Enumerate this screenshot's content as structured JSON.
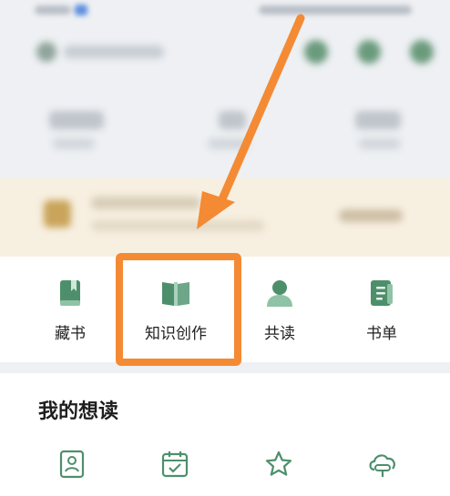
{
  "actions": [
    {
      "label": "藏书",
      "icon": "bookmark-book-icon"
    },
    {
      "label": "知识创作",
      "icon": "open-book-icon"
    },
    {
      "label": "共读",
      "icon": "person-icon"
    },
    {
      "label": "书单",
      "icon": "list-document-icon"
    }
  ],
  "wishlist": {
    "title": "我的想读",
    "icons": [
      "profile-card-icon",
      "calendar-check-icon",
      "star-icon",
      "cloud-icon"
    ]
  },
  "colors": {
    "accent_green": "#4e8f6b",
    "highlight_orange": "#f48a34",
    "card_bg": "#f7efe0"
  }
}
